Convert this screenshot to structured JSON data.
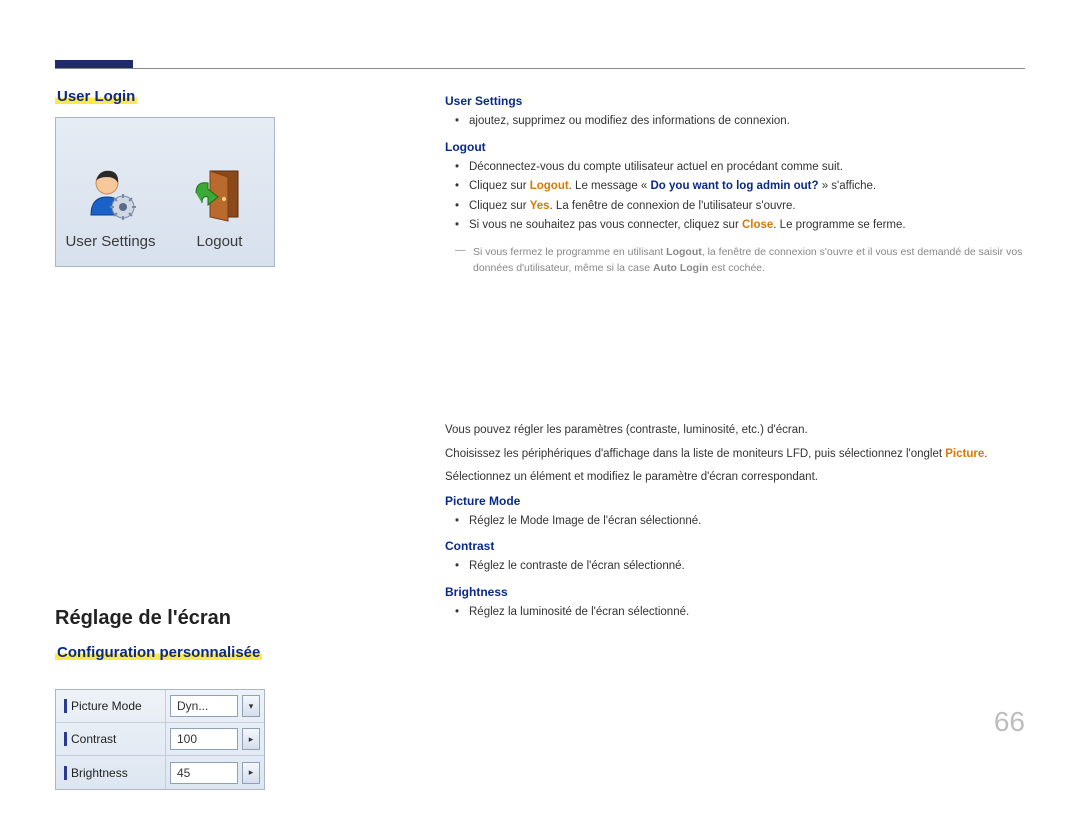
{
  "page_number": "66",
  "section_user_login": {
    "heading": "User Login",
    "panel": {
      "user_settings_label": "User Settings",
      "logout_label": "Logout"
    }
  },
  "section_screen": {
    "title": "Réglage de l'écran",
    "heading": "Configuration personnalisée",
    "panel": {
      "rows": {
        "picture_mode": {
          "label": "Picture Mode",
          "value": "Dyn..."
        },
        "contrast": {
          "label": "Contrast",
          "value": "100"
        },
        "brightness": {
          "label": "Brightness",
          "value": "45"
        }
      },
      "dropdown_glyph": "▾",
      "step_glyph": "▸"
    }
  },
  "right_user_login": {
    "user_settings_head": "User Settings",
    "user_settings_item": "ajoutez, supprimez ou modifiez des informations de connexion.",
    "logout_head": "Logout",
    "logout_items": {
      "i1": "Déconnectez-vous du compte utilisateur actuel en procédant comme suit.",
      "i2_pre": "Cliquez sur ",
      "i2_logout": "Logout",
      "i2_mid": ". Le message « ",
      "i2_msg": "Do you want to log admin out?",
      "i2_post": " » s'affiche.",
      "i3_pre": "Cliquez sur ",
      "i3_yes": "Yes",
      "i3_post": ". La fenêtre de connexion de l'utilisateur s'ouvre.",
      "i4_pre": "Si vous ne souhaitez pas vous connecter, cliquez sur ",
      "i4_close": "Close",
      "i4_post": ". Le programme se ferme."
    },
    "note_pre": "Si vous fermez le programme en utilisant ",
    "note_logout": "Logout",
    "note_mid": ", la fenêtre de connexion s'ouvre et il vous est demandé de saisir vos données d'utilisateur, même si la case ",
    "note_autologin": "Auto Login",
    "note_post": " est cochée."
  },
  "right_screen": {
    "p1": "Vous pouvez régler les paramètres (contraste, luminosité, etc.) d'écran.",
    "p2_pre": "Choisissez les périphériques d'affichage dans la liste de moniteurs LFD, puis sélectionnez l'onglet ",
    "p2_picture": "Picture",
    "p2_post": ".",
    "p3": "Sélectionnez un élément et modifiez le paramètre d'écran correspondant.",
    "picture_mode_head": "Picture Mode",
    "picture_mode_item": "Réglez le Mode Image de l'écran sélectionné.",
    "contrast_head": "Contrast",
    "contrast_item": "Réglez le contraste de l'écran sélectionné.",
    "brightness_head": "Brightness",
    "brightness_item": "Réglez la luminosité de l'écran sélectionné."
  }
}
